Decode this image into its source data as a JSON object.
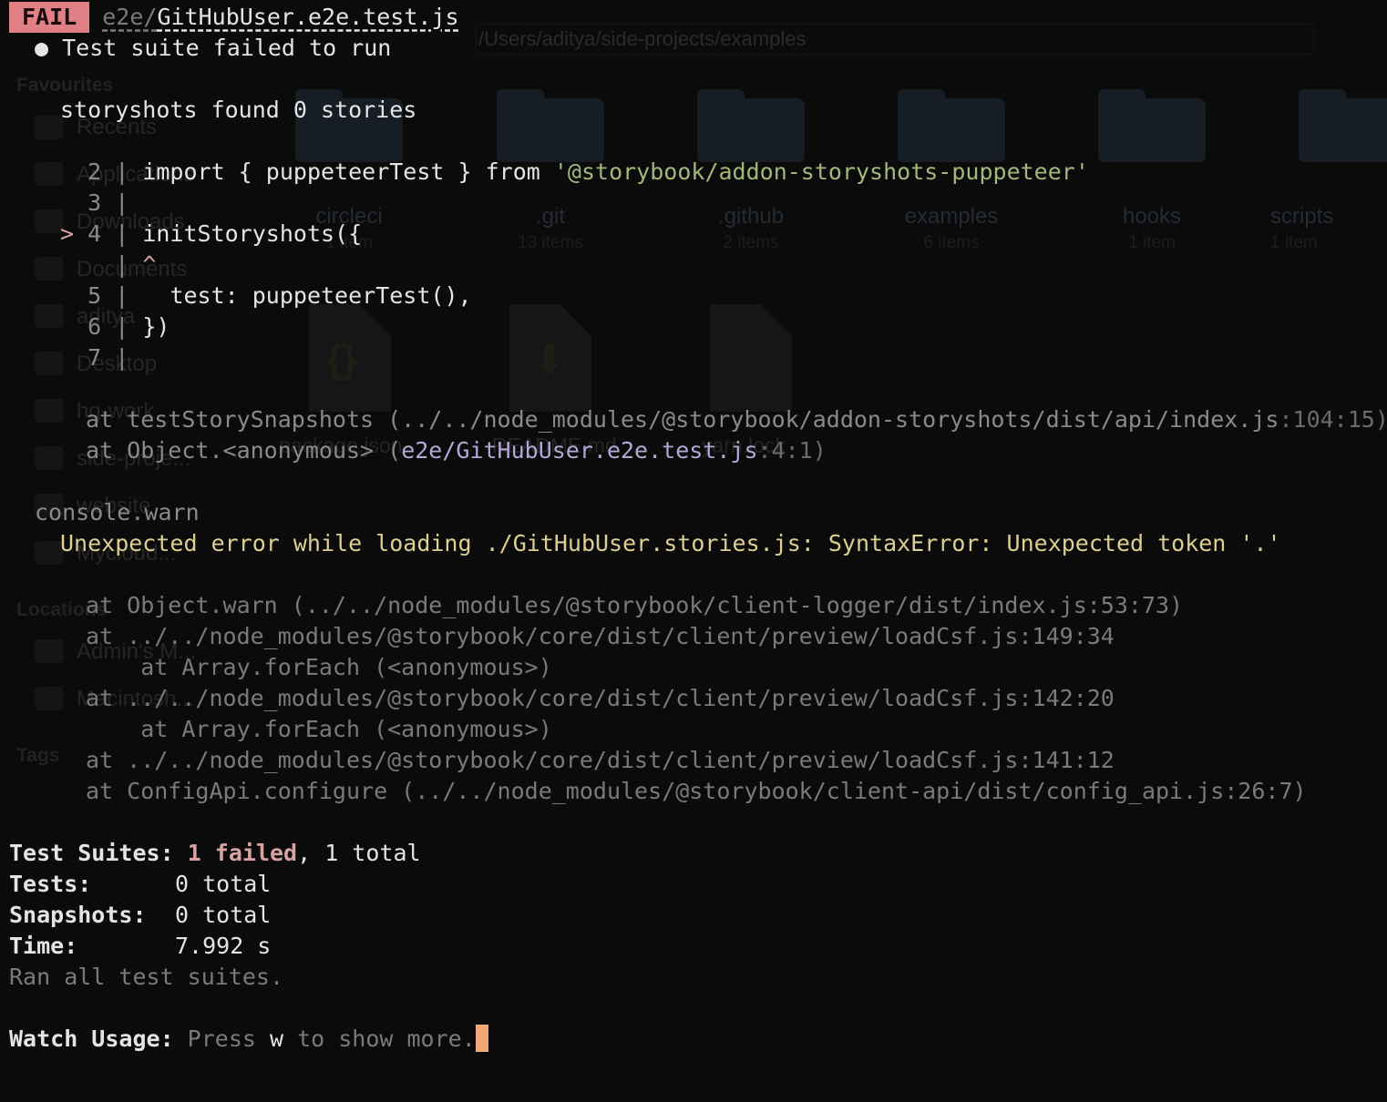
{
  "background": {
    "path_bar": "/Users/aditya/side-projects/examples",
    "sidebar": {
      "favourites_heading": "Favourites",
      "items": [
        "Recents",
        "Applications",
        "Downloads",
        "Documents",
        "aditya",
        "Desktop",
        "hq-work",
        "side-proje...",
        "website",
        "Mycloud..."
      ],
      "locations_heading": "Locations",
      "locations": [
        "Admin's M...",
        "Macintosh..."
      ],
      "tags_heading": "Tags"
    },
    "folders": [
      {
        "name": "circleci",
        "count": "1 item"
      },
      {
        "name": ".git",
        "count": "13 items"
      },
      {
        "name": ".github",
        "count": "2 items"
      },
      {
        "name": "examples",
        "count": "6 items"
      },
      {
        "name": "hooks",
        "count": "1 item"
      },
      {
        "name": "scripts",
        "count": "1 item"
      }
    ],
    "files": [
      {
        "name": "package.json",
        "mark": "{}"
      },
      {
        "name": "README.md",
        "mark": "⬇"
      },
      {
        "name": "yarn.lock",
        "mark": ""
      }
    ]
  },
  "terminal": {
    "fail_badge": "FAIL",
    "test_file_dir": "e2e/",
    "test_file_name": "GitHubUser.e2e.test.js",
    "bullet_message": "● Test suite failed to run",
    "stories_message": "storyshots found 0 stories",
    "code_lines": [
      {
        "marker": "  ",
        "num": "2",
        "sep": " | ",
        "code_plain": "import { puppeteerTest } from ",
        "code_string": "'@storybook/addon-storyshots-puppeteer'"
      },
      {
        "marker": "  ",
        "num": "3",
        "sep": " |",
        "code_plain": "",
        "code_string": ""
      },
      {
        "marker": "> ",
        "num": "4",
        "sep": " | ",
        "code_plain": "initStoryshots({",
        "code_string": ""
      },
      {
        "marker": "  ",
        "num": " ",
        "sep": " | ",
        "code_plain": "^",
        "code_string": ""
      },
      {
        "marker": "  ",
        "num": "5",
        "sep": " |   ",
        "code_plain": "test: puppeteerTest(),",
        "code_string": ""
      },
      {
        "marker": "  ",
        "num": "6",
        "sep": " | ",
        "code_plain": "})",
        "code_string": ""
      },
      {
        "marker": "  ",
        "num": "7",
        "sep": " |",
        "code_plain": "",
        "code_string": ""
      }
    ],
    "stack_1": {
      "line1_prefix": "at testStorySnapshots (../../node_modules/@storybook/addon-storyshots/dist/api/index.js",
      "line1_suffix": ":104:15)",
      "line2_prefix": "at Object.<anonymous> (",
      "line2_path": "e2e/GitHubUser.e2e.test.js",
      "line2_suffix": ":4:1)"
    },
    "console_warn_label": "console.warn",
    "warn_message": "Unexpected error while loading ./GitHubUser.stories.js: SyntaxError: Unexpected token '.'",
    "stack_2": [
      "at Object.warn (../../node_modules/@storybook/client-logger/dist/index.js:53:73)",
      "at ../../node_modules/@storybook/core/dist/client/preview/loadCsf.js:149:34",
      "    at Array.forEach (<anonymous>)",
      "at ../../node_modules/@storybook/core/dist/client/preview/loadCsf.js:142:20",
      "    at Array.forEach (<anonymous>)",
      "at ../../node_modules/@storybook/core/dist/client/preview/loadCsf.js:141:12",
      "at ConfigApi.configure (../../node_modules/@storybook/client-api/dist/config_api.js:26:7)"
    ],
    "summary": {
      "suites_label": "Test Suites:",
      "suites_failed": "1 failed",
      "suites_total": ", 1 total",
      "tests_label": "Tests:",
      "tests_value": "0 total",
      "snapshots_label": "Snapshots:",
      "snapshots_value": "0 total",
      "time_label": "Time:",
      "time_value": "7.992 s",
      "ran_all": "Ran all test suites."
    },
    "watch_label": "Watch Usage:",
    "watch_press": " Press ",
    "watch_key": "w",
    "watch_rest": " to show more."
  },
  "colors": {
    "fail_badge_bg": "#e07f84",
    "cursor": "#f0a87a",
    "string": "#a4b77a",
    "warning": "#dccf91",
    "failed": "#d9a2a2"
  }
}
